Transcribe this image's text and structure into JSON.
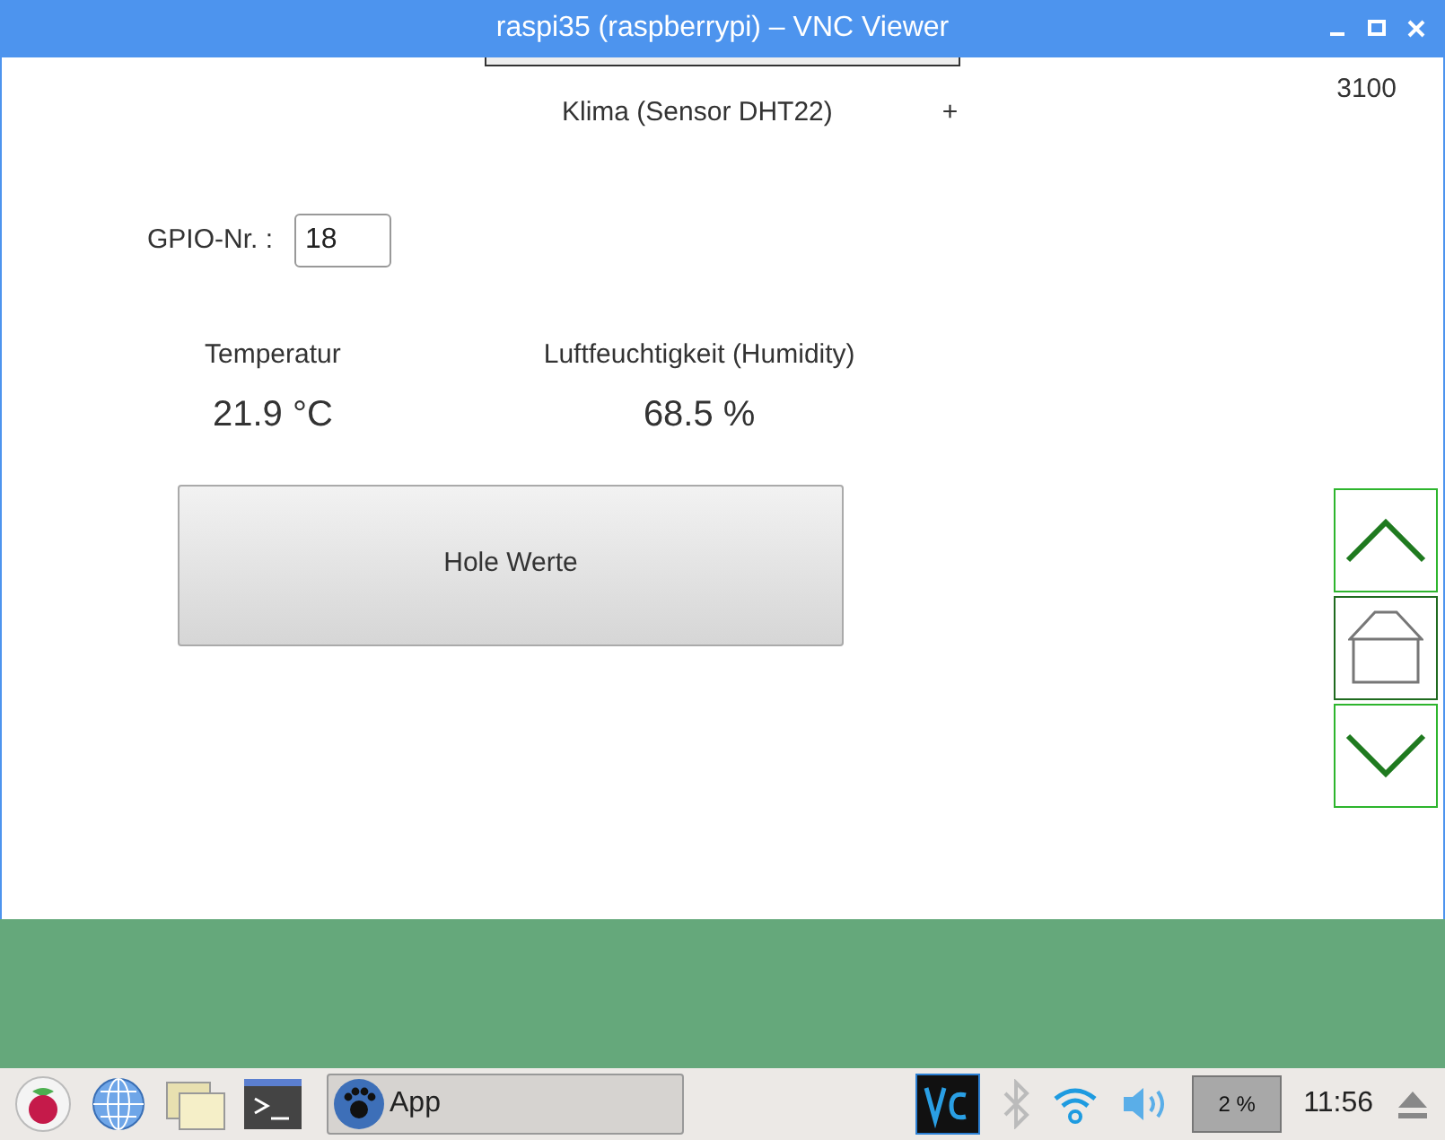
{
  "window": {
    "title": "raspi35 (raspberrypi) – VNC Viewer"
  },
  "app": {
    "heading": "Klima (Sensor DHT22)",
    "add_symbol": "+",
    "counter": "3100",
    "gpio": {
      "label": "GPIO-Nr. :",
      "value": "18"
    },
    "readings": [
      {
        "label": "Temperatur",
        "value": "21.9 °C"
      },
      {
        "label": "Luftfeuchtigkeit (Humidity)",
        "value": "68.5 %"
      }
    ],
    "fetch_button": "Hole Werte"
  },
  "taskbar": {
    "app_button": "App",
    "cpu": "2 %",
    "clock": "11:56"
  }
}
